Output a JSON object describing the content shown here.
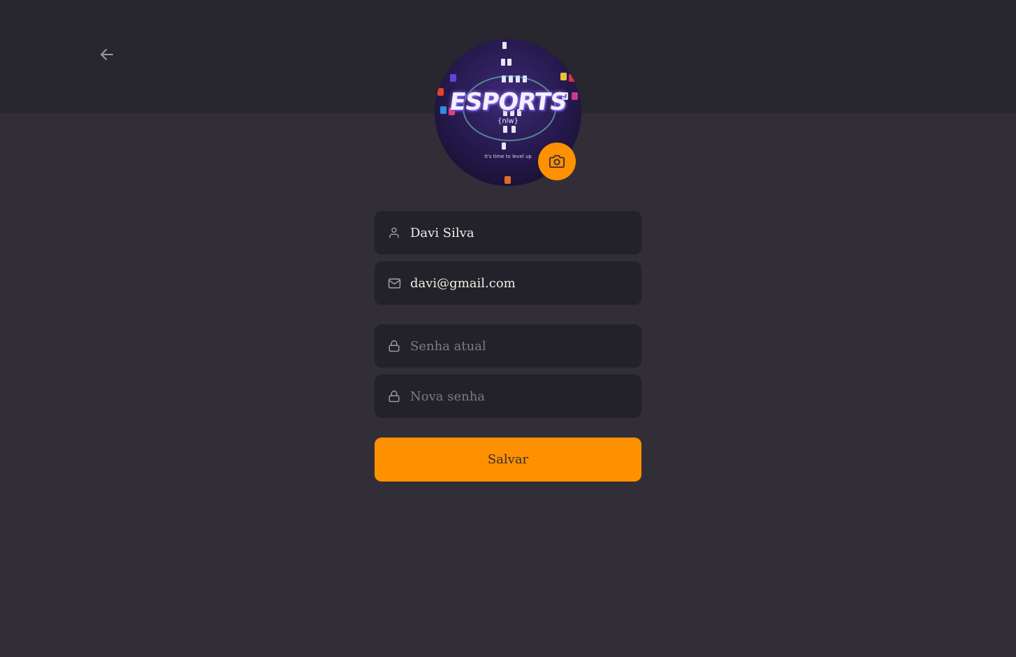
{
  "profile": {
    "name": "Davi Silva",
    "email": "davi@gmail.com",
    "current_password_placeholder": "Senha atual",
    "new_password_placeholder": "Nova senha",
    "save_label": "Salvar"
  },
  "avatar": {
    "logo_text": "ESPORTS",
    "logo_sub": "{nlw}",
    "tagline": "It's time to level up"
  },
  "icons": {
    "back": "arrow-left-icon",
    "camera": "camera-icon",
    "user": "user-icon",
    "mail": "mail-icon",
    "lock": "lock-icon"
  },
  "colors": {
    "background": "#312e38",
    "header": "#28262e",
    "input_background": "#232129",
    "accent": "#ff9000",
    "text": "#f4ede8",
    "placeholder": "#7d7a83",
    "icon": "#9c98a6"
  }
}
